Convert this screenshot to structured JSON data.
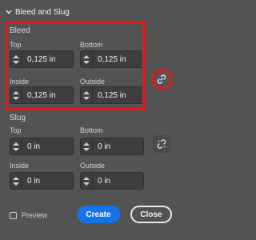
{
  "section": {
    "title": "Bleed and Slug"
  },
  "bleed": {
    "title": "Bleed",
    "top": {
      "label": "Top",
      "value": "0,125 in"
    },
    "bottom": {
      "label": "Bottom",
      "value": "0,125 in"
    },
    "inside": {
      "label": "Inside",
      "value": "0,125 in"
    },
    "outside": {
      "label": "Outside",
      "value": "0,125 in"
    }
  },
  "slug": {
    "title": "Slug",
    "top": {
      "label": "Top",
      "value": "0 in"
    },
    "bottom": {
      "label": "Bottom",
      "value": "0 in"
    },
    "inside": {
      "label": "Inside",
      "value": "0 in"
    },
    "outside": {
      "label": "Outside",
      "value": "0 in"
    }
  },
  "footer": {
    "preview_label": "Preview",
    "create_label": "Create",
    "close_label": "Close"
  },
  "colors": {
    "panel_bg": "#535353",
    "field_bg": "#3e3e3e",
    "accent_blue": "#1473e6",
    "highlight_red": "#e21b1b"
  },
  "icons": {
    "section_toggle": "chevron-down-icon",
    "bleed_link": "link-icon",
    "slug_link": "link-broken-icon"
  }
}
